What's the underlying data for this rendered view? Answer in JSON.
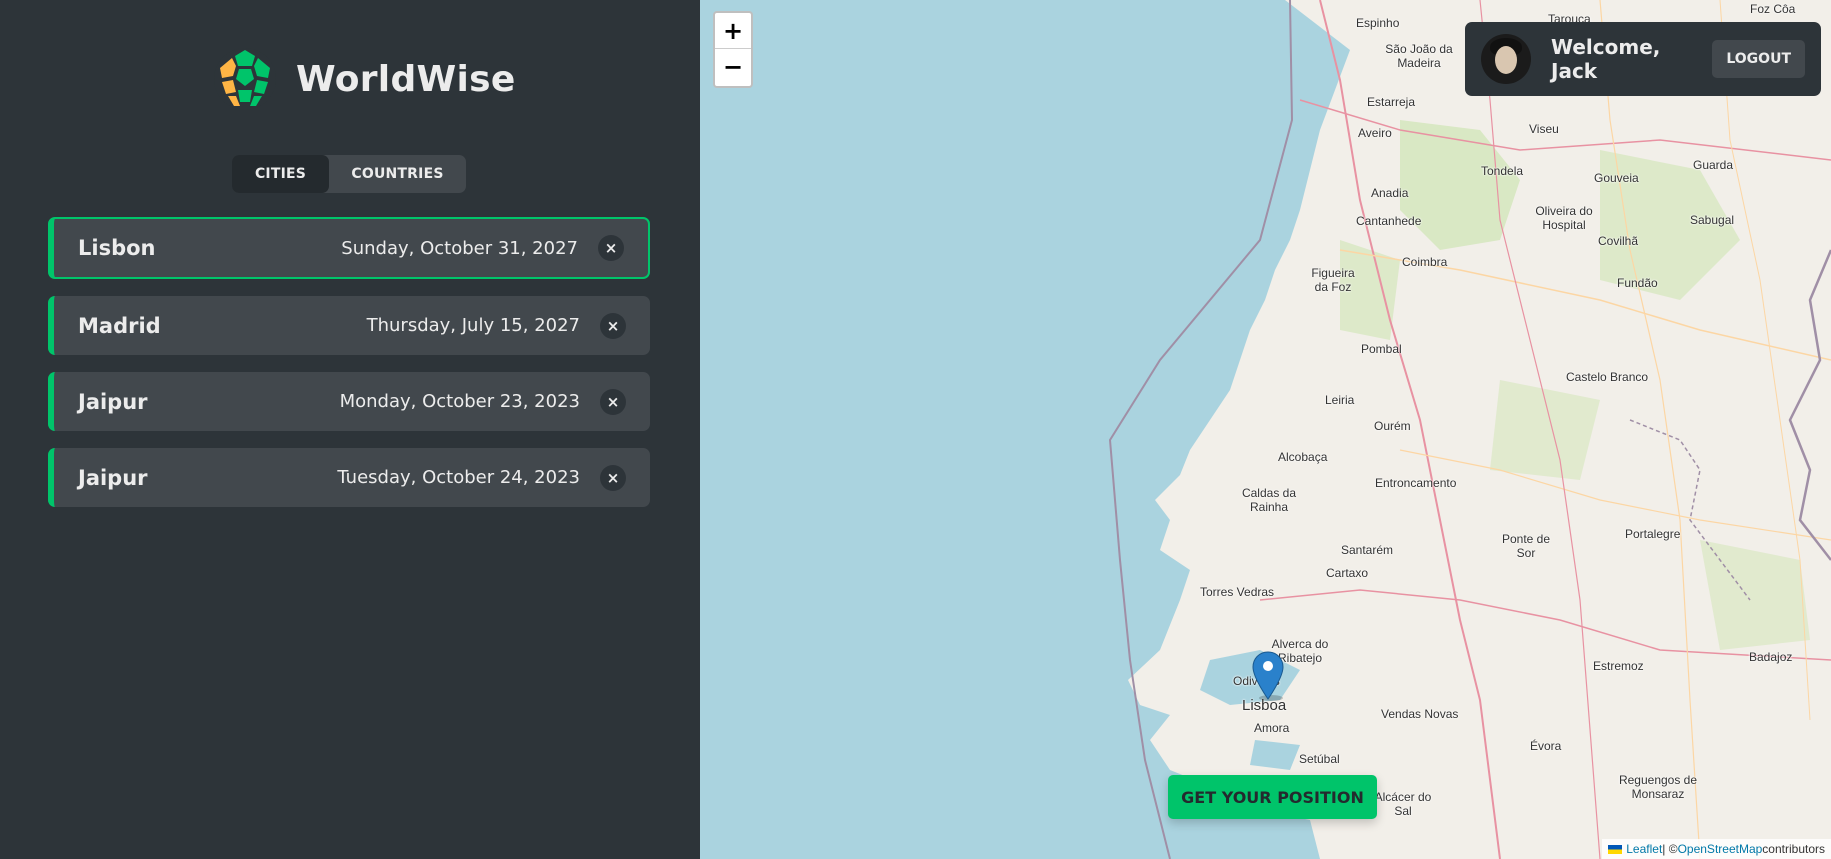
{
  "app": {
    "name": "WorldWise"
  },
  "nav": {
    "tabs": [
      {
        "label": "CITIES"
      },
      {
        "label": "COUNTRIES"
      }
    ]
  },
  "cities": [
    {
      "name": "Lisbon",
      "date": "Sunday, October 31, 2027",
      "delete_label": "×"
    },
    {
      "name": "Madrid",
      "date": "Thursday, July 15, 2027",
      "delete_label": "×"
    },
    {
      "name": "Jaipur",
      "date": "Monday, October 23, 2023",
      "delete_label": "×"
    },
    {
      "name": "Jaipur",
      "date": "Tuesday, October 24, 2023",
      "delete_label": "×"
    }
  ],
  "map": {
    "zoom_in": "+",
    "zoom_out": "−",
    "user": {
      "welcome": "Welcome, Jack",
      "logout_label": "LOGOUT"
    },
    "position_button": "GET YOUR POSITION",
    "attribution": {
      "leaflet": "Leaflet",
      "separator": " | © ",
      "osm": "OpenStreetMap",
      "suffix": " contributors"
    },
    "place_labels": [
      "Espinho",
      "São João da Madeira",
      "Estarreja",
      "Aveiro",
      "Viseu",
      "Tondela",
      "Gouveia",
      "Guarda",
      "Anadia",
      "Oliveira do Hospital",
      "Sabugal",
      "Cantanhede",
      "Covilhã",
      "Coimbra",
      "Figueira da Foz",
      "Fundão",
      "Pombal",
      "Castelo Branco",
      "Leiria",
      "Ourém",
      "Alcobaça",
      "Entroncamento",
      "Caldas da Rainha",
      "Ponte de Sor",
      "Portalegre",
      "Santarém",
      "Cartaxo",
      "Torres Vedras",
      "Alverca do Ribatejo",
      "Odivelas",
      "Lisboa",
      "Amora",
      "Vendas Novas",
      "Estremoz",
      "Badajoz",
      "Évora",
      "Setúbal",
      "Reguengos de Monsaraz",
      "Alcácer do Sal",
      "Tarouca",
      "Foz Côa"
    ]
  },
  "colors": {
    "accent": "#00c46a",
    "sidebar": "#2d3439",
    "card": "#42484d",
    "sea": "#aad3df",
    "land": "#f2efe9"
  },
  "icons": {
    "logo": "globe-logo-icon",
    "marker": "map-pin-icon"
  }
}
